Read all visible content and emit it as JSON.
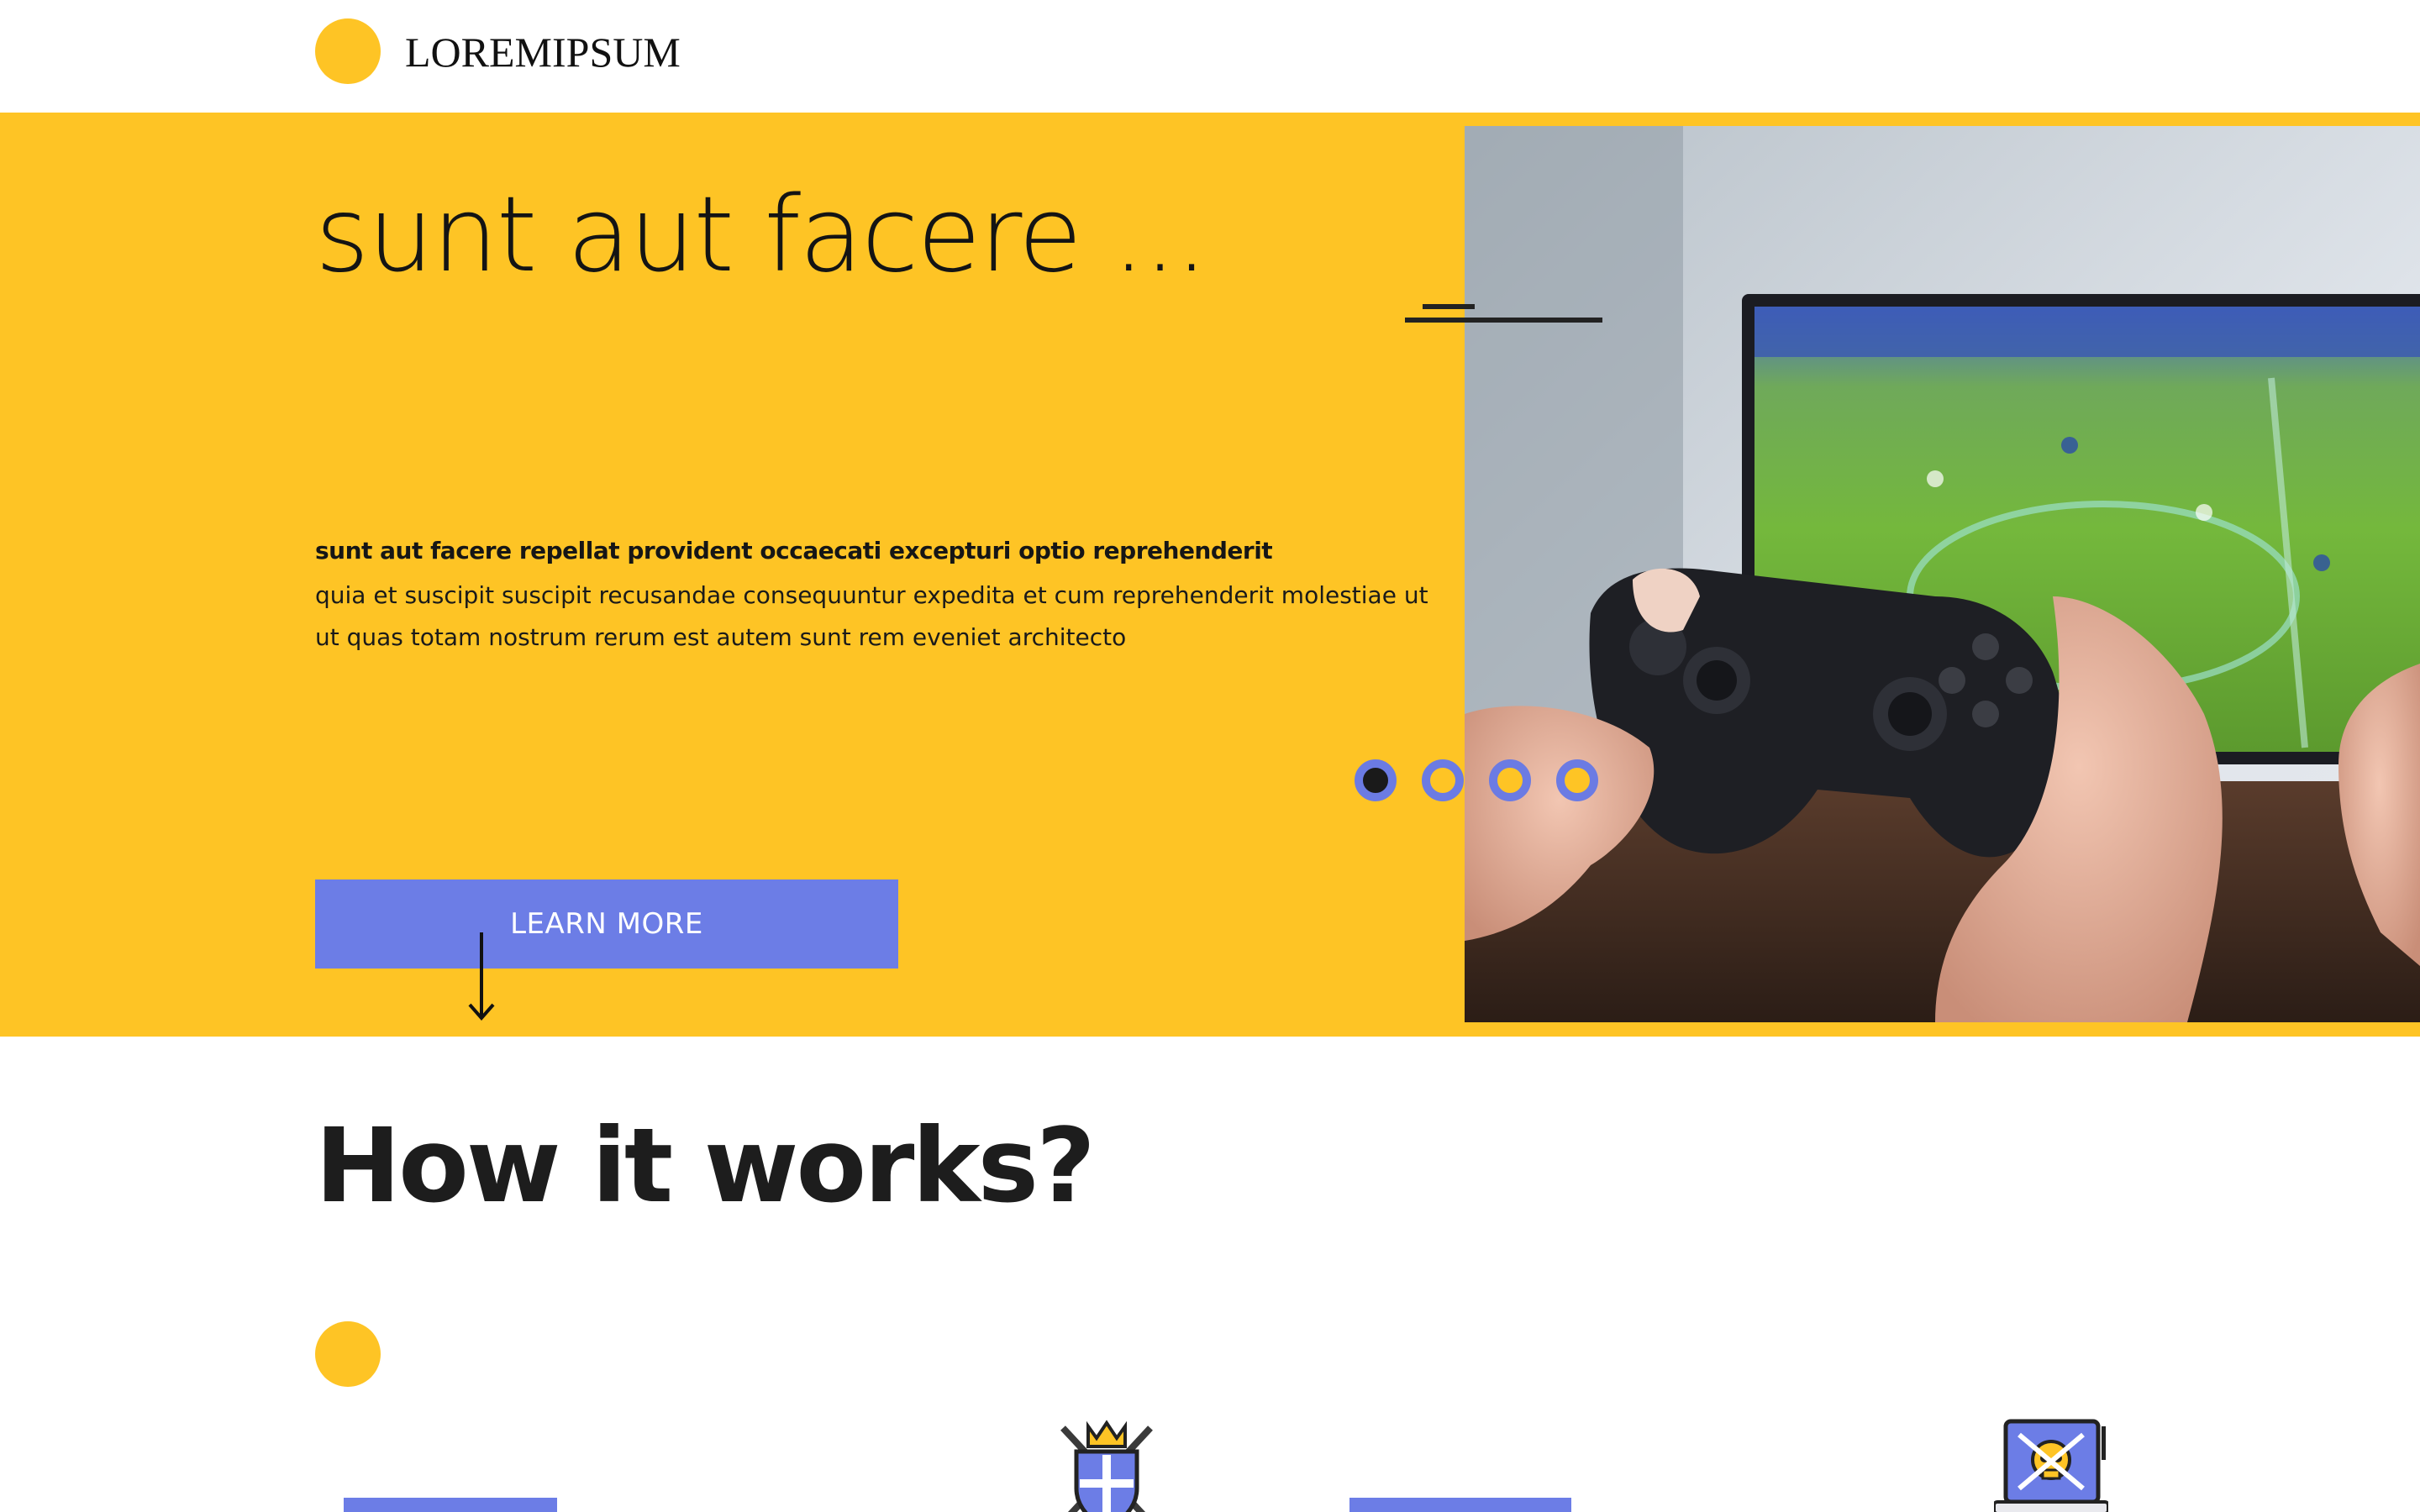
{
  "brand": {
    "logo_text": "LOREMIPSUM",
    "accent": "#fec425",
    "primary": "#6c7de6"
  },
  "hero": {
    "title": "sunt aut facere ...",
    "subhead": "sunt aut facere repellat provident occaecati excepturi optio reprehenderit",
    "body": "quia et suscipit suscipit recusandae consequuntur expedita et cum reprehenderit molestiae ut ut quas totam nostrum rerum est autem sunt rem eveniet architecto",
    "cta_label": "LEARN MORE",
    "image": "gamer-holding-controller-photo",
    "carousel": {
      "total": 4,
      "active_index": 0
    }
  },
  "how_it_works": {
    "title": "How it works?",
    "icons": [
      "crest-shield-icon",
      "pirate-monitor-icon"
    ]
  }
}
